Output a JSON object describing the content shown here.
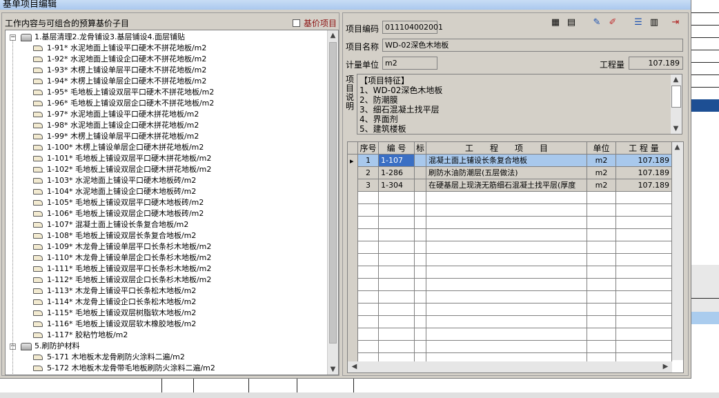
{
  "window": {
    "title": "基单项目编辑"
  },
  "left": {
    "header": "工作内容与可组合的预算基价子目",
    "checkbox_label": "基价项目",
    "tree": [
      {
        "type": "group",
        "text": "1.基层清理2.龙骨铺设3.基层铺设4.面层铺贴"
      },
      {
        "type": "item",
        "text": "1-91* 水泥地面上铺设平口硬木不拼花地板/m2"
      },
      {
        "type": "item",
        "text": "1-92* 水泥地面上铺设企口硬木不拼花地板/m2"
      },
      {
        "type": "item",
        "text": "1-93* 木楞上铺设单层平口硬木不拼花地板/m2"
      },
      {
        "type": "item",
        "text": "1-94* 木楞上铺设单层企口硬木不拼花地板/m2"
      },
      {
        "type": "item",
        "text": "1-95* 毛地板上铺设双层平口硬木不拼花地板/m2"
      },
      {
        "type": "item",
        "text": "1-96* 毛地板上铺设双层企口硬木不拼花地板/m2"
      },
      {
        "type": "item",
        "text": "1-97* 水泥地面上铺设平口硬木拼花地板/m2"
      },
      {
        "type": "item",
        "text": "1-98* 水泥地面上铺设企口硬木拼花地板/m2"
      },
      {
        "type": "item",
        "text": "1-99* 木楞上铺设单层平口硬木拼花地板/m2"
      },
      {
        "type": "item",
        "text": "1-100* 木楞上铺设单层企口硬木拼花地板/m2"
      },
      {
        "type": "item",
        "text": "1-101* 毛地板上铺设双层平口硬木拼花地板/m2"
      },
      {
        "type": "item",
        "text": "1-102* 毛地板上铺设双层企口硬木拼花地板/m2"
      },
      {
        "type": "item",
        "text": "1-103* 水泥地面上铺设平口硬木地板砖/m2"
      },
      {
        "type": "item",
        "text": "1-104* 水泥地面上铺设企口硬木地板砖/m2"
      },
      {
        "type": "item",
        "text": "1-105* 毛地板上铺设双层平口硬木地板砖/m2"
      },
      {
        "type": "item",
        "text": "1-106* 毛地板上铺设双层企口硬木地板砖/m2"
      },
      {
        "type": "item",
        "text": "1-107* 混凝土面上铺设长条复合地板/m2"
      },
      {
        "type": "item",
        "text": "1-108* 毛地板上铺设双层长条复合地板/m2"
      },
      {
        "type": "item",
        "text": "1-109* 木龙骨上铺设单层平口长条杉木地板/m2"
      },
      {
        "type": "item",
        "text": "1-110* 木龙骨上铺设单层企口长条杉木地板/m2"
      },
      {
        "type": "item",
        "text": "1-111* 毛地板上铺设双层平口长条杉木地板/m2"
      },
      {
        "type": "item",
        "text": "1-112* 毛地板上铺设双层企口长条杉木地板/m2"
      },
      {
        "type": "item",
        "text": "1-113* 木龙骨上铺设平口长条松木地板/m2"
      },
      {
        "type": "item",
        "text": "1-114* 木龙骨上铺设企口长条松木地板/m2"
      },
      {
        "type": "item",
        "text": "1-115* 毛地板上铺设双层树脂软木地板/m2"
      },
      {
        "type": "item",
        "text": "1-116* 毛地板上铺设双层软木橡胶地板/m2"
      },
      {
        "type": "item",
        "text": "1-117* 胶粘竹地板/m2"
      },
      {
        "type": "group",
        "text": "5.刷防护材料"
      },
      {
        "type": "item",
        "text": "5-171 木地板木龙骨刷防火涂料二遍/m2"
      },
      {
        "type": "item",
        "text": "5-172 木地板木龙骨带毛地板刷防火涂料二遍/m2"
      }
    ]
  },
  "right": {
    "code_label": "项目编码",
    "code_value": "011104002001",
    "name_label": "项目名称",
    "name_value": "WD-02深色木地板",
    "unit_label": "计量单位",
    "unit_value": "m2",
    "qty_label": "工程量",
    "qty_value": "107.189",
    "desc_label": "项目说明",
    "features": [
      "【项目特征】",
      "1、WD-02深色木地板",
      "2、防潮膜",
      "3、细石混凝土找平层",
      "4、界面剂",
      "5、建筑楼板"
    ],
    "toolbar": [
      "calculator-icon",
      "table-icon",
      "edit-icon",
      "pencil-icon",
      "list-icon",
      "settings-icon",
      "exit-icon"
    ],
    "grid": {
      "headers": [
        "序号",
        "编 号",
        "标",
        "工　　程　　项　　目",
        "单位",
        "工 程 量"
      ],
      "rows": [
        {
          "no": "1",
          "code": "1-107",
          "flag": "",
          "name": "混凝土面上铺设长条复合地板",
          "unit": "m2",
          "qty": "107.189"
        },
        {
          "no": "2",
          "code": "1-286",
          "flag": "",
          "name": "刷防水油防潮层(五层做法)",
          "unit": "m2",
          "qty": "107.189"
        },
        {
          "no": "3",
          "code": "1-304",
          "flag": "",
          "name": "在硬基层上现浇无筋细石混凝土找平层(厚度",
          "unit": "m2",
          "qty": "107.189"
        }
      ]
    }
  },
  "colors": {
    "selected_row": "#a8c8ec",
    "title_bar": "#b8d4f4",
    "label_red": "#8b1010",
    "bg_blue": "#1d4f94"
  }
}
